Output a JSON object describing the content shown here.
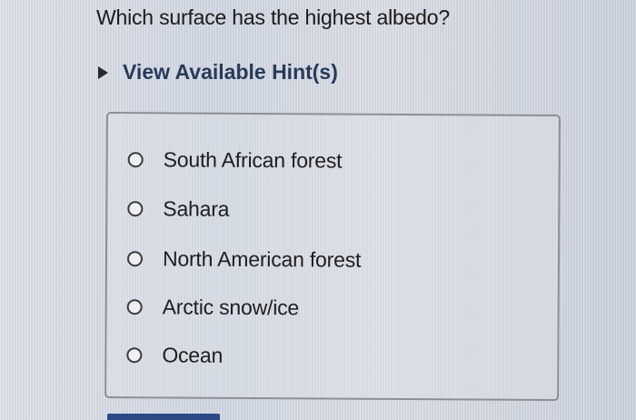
{
  "question": {
    "text": "Which surface has the highest albedo?"
  },
  "hint": {
    "label": "View Available Hint(s)",
    "icon": "caret-right-icon"
  },
  "options": [
    {
      "label": "South African forest",
      "selected": false
    },
    {
      "label": "Sahara",
      "selected": false
    },
    {
      "label": "North American forest",
      "selected": false
    },
    {
      "label": "Arctic snow/ice",
      "selected": false
    },
    {
      "label": "Ocean",
      "selected": false
    }
  ],
  "colors": {
    "hint_text": "#273b5a",
    "button": "#2b4a86",
    "text": "#1e1e1e"
  }
}
